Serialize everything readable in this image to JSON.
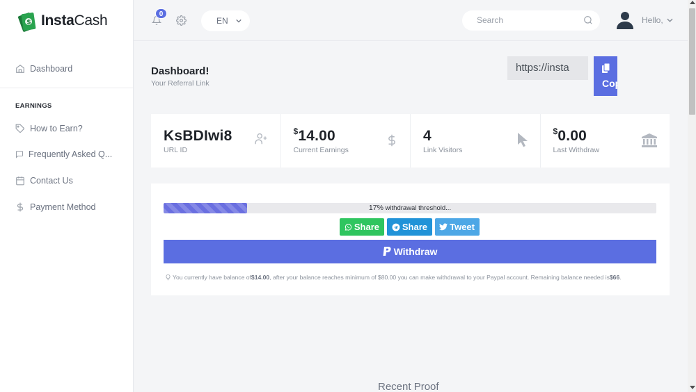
{
  "brand": {
    "name_bold": "Insta",
    "name_light": "Cash",
    "accent": "#5b6ee1"
  },
  "sidebar": {
    "dashboard": "Dashboard",
    "section_heading": "EARNINGS",
    "items": [
      {
        "label": "How to Earn?",
        "icon": "tag-icon"
      },
      {
        "label": "Frequently Asked Q...",
        "icon": "chat-icon"
      },
      {
        "label": "Contact Us",
        "icon": "calendar-icon"
      },
      {
        "label": "Payment Method",
        "icon": "dollar-icon"
      }
    ]
  },
  "topbar": {
    "notification_count": "0",
    "language": "EN",
    "search_placeholder": "Search",
    "greeting": "Hello,"
  },
  "header": {
    "title": "Dashboard!",
    "subtitle": "Your Referral Link",
    "referral_link": "https://insta",
    "copy_label": "Copy"
  },
  "stats": [
    {
      "prefix": "",
      "value": "KsBDIwi8",
      "label": "URL ID",
      "icon": "add-user-icon"
    },
    {
      "prefix": "$",
      "value": "14.00",
      "label": "Current Earnings",
      "icon": "dollar-icon"
    },
    {
      "prefix": "",
      "value": "4",
      "label": "Link Visitors",
      "icon": "cursor-icon"
    },
    {
      "prefix": "$",
      "value": "0.00",
      "label": "Last Withdraw",
      "icon": "bank-icon"
    }
  ],
  "progress": {
    "percent": 17,
    "percent_text": "17%",
    "label": " withdrawal threshold..."
  },
  "share": {
    "whatsapp": "Share",
    "telegram": "Share",
    "twitter": "Tweet"
  },
  "withdraw_label": "Withdraw",
  "note": {
    "t1": "You currently have balance of ",
    "balance": "$14.00",
    "t2": ", after your balance reaches minimum of $80.00 you can make withdrawal to your Paypal account. Remaining balance needed is ",
    "remaining": "$66",
    "t3": "."
  },
  "recent_title": "Recent Proof"
}
